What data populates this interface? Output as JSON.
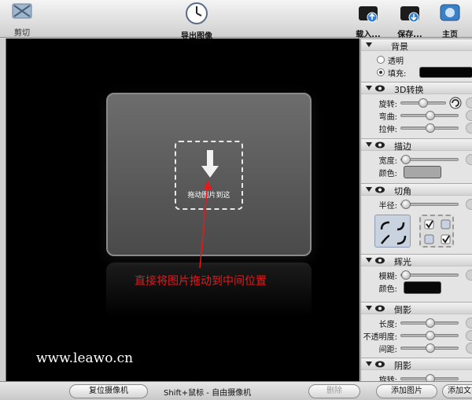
{
  "toolbar": {
    "cut_label": "剪切",
    "export_label": "导出图像",
    "load_label": "载入...",
    "save_label": "保存...",
    "home_label": "主页"
  },
  "canvas": {
    "drop_text": "拖动图片到这",
    "annotation": "直接将图片拖动到中间位置",
    "watermark": "www.leawo.cn"
  },
  "panel": {
    "background": {
      "title": "背景",
      "transparent": "透明",
      "fill": "填充:"
    },
    "transform3d": {
      "title": "3D转换",
      "rotate": "旋转:",
      "bend": "弯曲:",
      "stretch": "拉伸:"
    },
    "stroke": {
      "title": "描边",
      "width": "宽度:",
      "color": "颜色:"
    },
    "corner": {
      "title": "切角",
      "radius": "半径:"
    },
    "glow": {
      "title": "辉光",
      "blur": "模糊:",
      "color": "颜色:"
    },
    "shadow": {
      "title": "倒影",
      "length": "长度:",
      "opacity": "不透明度:",
      "spacing": "间距:"
    },
    "drop_shadow": {
      "title": "阴影",
      "rotate": "旋转:"
    }
  },
  "bottombar": {
    "reset_camera": "复位摄像机",
    "hint": "Shift+鼠标 - 自由摄像机",
    "delete": "删除",
    "add_image": "添加图片",
    "add_text": "添加文字"
  },
  "colors": {
    "annotation": "#e8181b",
    "canvas_bg": "#000000",
    "panel_bg": "#e4e4e4"
  },
  "icons": [
    "cut-icon",
    "clock-icon",
    "load-icon",
    "save-icon",
    "home-icon",
    "eye-icon",
    "rotate-icon",
    "arrow-down-icon"
  ]
}
